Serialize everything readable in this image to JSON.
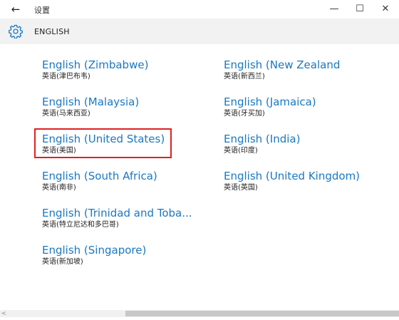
{
  "window": {
    "title": "设置",
    "back_icon": "←",
    "minimize_icon": "—",
    "maximize_icon": "☐",
    "close_icon": "✕"
  },
  "header": {
    "icon": "gear-icon",
    "title": "ENGLISH"
  },
  "languages": [
    {
      "name": "English (Zimbabwe)",
      "native": "英语(津巴布韦)"
    },
    {
      "name": "English (New Zealand",
      "native": "英语(新西兰)"
    },
    {
      "name": "English (Malaysia)",
      "native": "英语(马来西亚)"
    },
    {
      "name": "English (Jamaica)",
      "native": "英语(牙买加)"
    },
    {
      "name": "English (United States)",
      "native": "英语(美国)",
      "highlighted": true
    },
    {
      "name": "English (India)",
      "native": "英语(印度)"
    },
    {
      "name": "English (South Africa)",
      "native": "英语(南非)"
    },
    {
      "name": "English (United Kingdom)",
      "native": "英语(英国)"
    },
    {
      "name": "English (Trinidad and Toba...",
      "native": "英语(特立尼达和多巴哥)"
    },
    {
      "name": "English (Singapore)",
      "native": "英语(新加坡)"
    }
  ],
  "colors": {
    "link": "#1a78c2",
    "header_bg": "#f2f2f2",
    "highlight": "#e02020"
  }
}
